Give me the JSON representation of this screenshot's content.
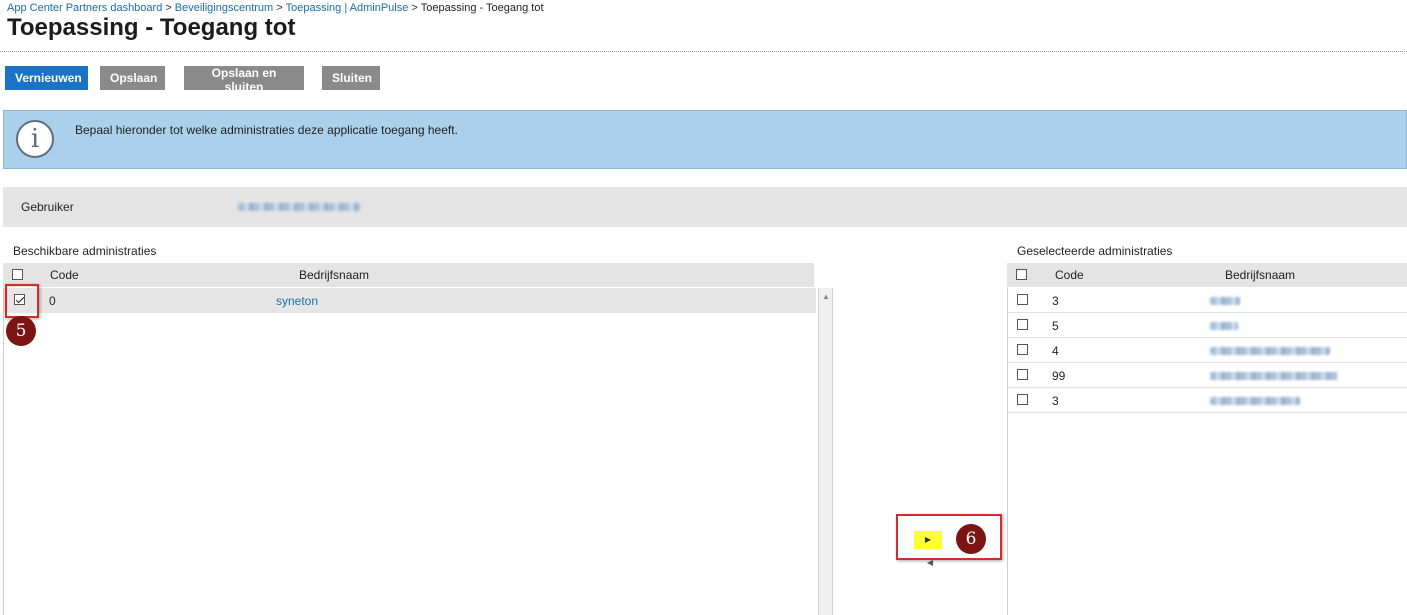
{
  "breadcrumb": {
    "items": [
      "App Center Partners dashboard",
      "Beveiligingscentrum",
      "Toepassing | AdminPulse"
    ],
    "separator": ">",
    "current": "Toepassing - Toegang tot"
  },
  "page": {
    "title": "Toepassing - Toegang tot"
  },
  "toolbar": {
    "refresh_label": "Vernieuwen",
    "save_label": "Opslaan",
    "save_close_label": "Opslaan en sluiten",
    "close_label": "Sluiten"
  },
  "info": {
    "icon": "info-icon",
    "glyph": "i",
    "text": "Bepaal hieronder tot welke administraties deze applicatie toegang heeft."
  },
  "user": {
    "label": "Gebruiker",
    "value": ""
  },
  "available": {
    "title": "Beschikbare administraties",
    "columns": {
      "code": "Code",
      "name": "Bedrijfsnaam"
    },
    "rows": [
      {
        "code": "0",
        "name": "syneton",
        "checked": true
      }
    ]
  },
  "selected": {
    "title": "Geselecteerde administraties",
    "columns": {
      "code": "Code",
      "name": "Bedrijfsnaam"
    },
    "rows": [
      {
        "code": "3",
        "name": "",
        "checked": false
      },
      {
        "code": "5",
        "name": "",
        "checked": false
      },
      {
        "code": "4",
        "name": "",
        "checked": false
      },
      {
        "code": "99",
        "name": "",
        "checked": false
      },
      {
        "code": "3",
        "name": "",
        "checked": false
      }
    ]
  },
  "transfer": {
    "move_right_glyph": "▶",
    "move_left_glyph": "◀"
  },
  "annotations": {
    "step5": "5",
    "step6": "6"
  },
  "colors": {
    "primary": "#1a73c4",
    "info_bg": "#aad0ec",
    "marker": "#7d1414",
    "highlight": "#d42b2b",
    "arrow_bg": "#ffff33"
  }
}
